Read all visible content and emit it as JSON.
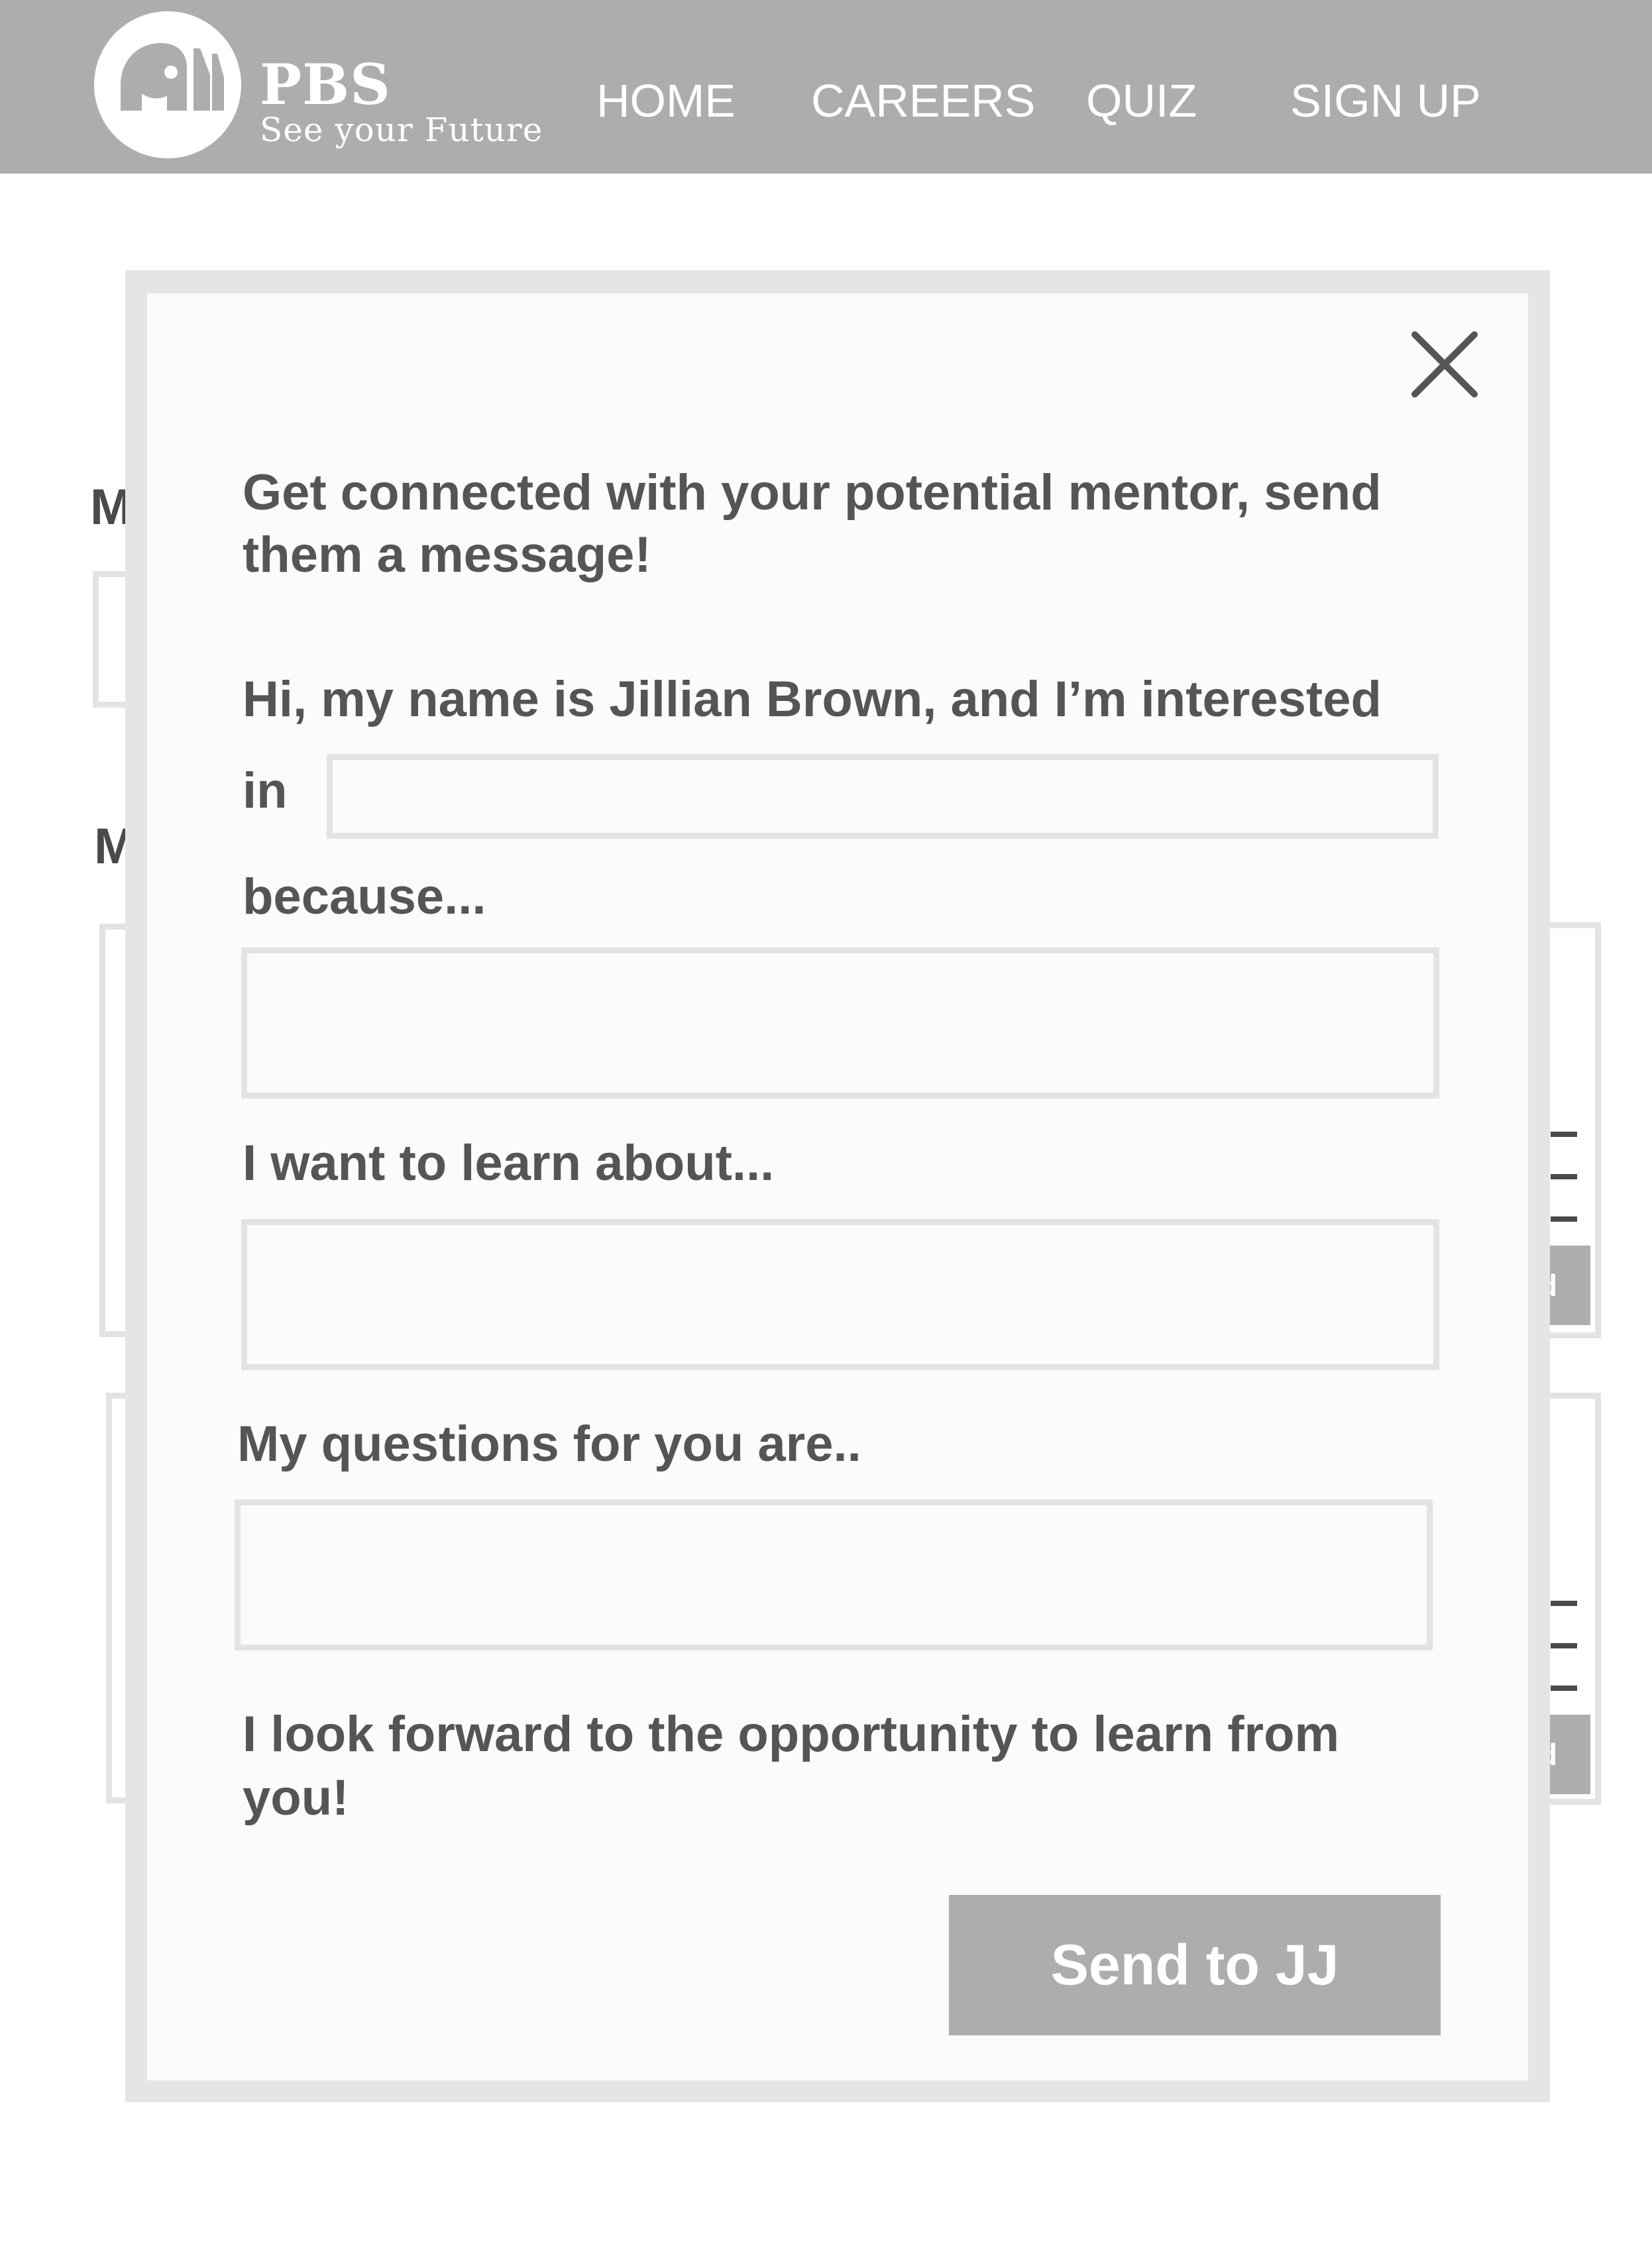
{
  "header": {
    "brand": "PBS",
    "tagline": "See your Future",
    "nav": [
      "HOME",
      "CAREERS",
      "QUIZ",
      "SIGN UP"
    ],
    "background_color": "#adadac"
  },
  "modal": {
    "intro": [
      "Get connected with your potential mentor, send",
      "them a message!"
    ],
    "greeting": "Hi, my name is Jillian Brown, and I’m interested",
    "in_label": "in",
    "because_label": "because...",
    "learn_label": "I want to learn about...",
    "questions_label": "My questions for you are..",
    "closing": [
      "I look forward to the opportunity to learn from",
      "you!"
    ],
    "interest_value": "",
    "because_value": "",
    "learn_value": "",
    "questions_value": "",
    "send_label": "Send to JJ",
    "close_icon": "close-icon"
  },
  "background": {
    "letters": [
      "M",
      "M"
    ],
    "button_fragment": [
      "d",
      "d"
    ]
  },
  "colors": {
    "accent_gray": "#adadac",
    "text": "#555555",
    "border": "#e3e3e3",
    "modal_bg": "#fbfbf9"
  }
}
